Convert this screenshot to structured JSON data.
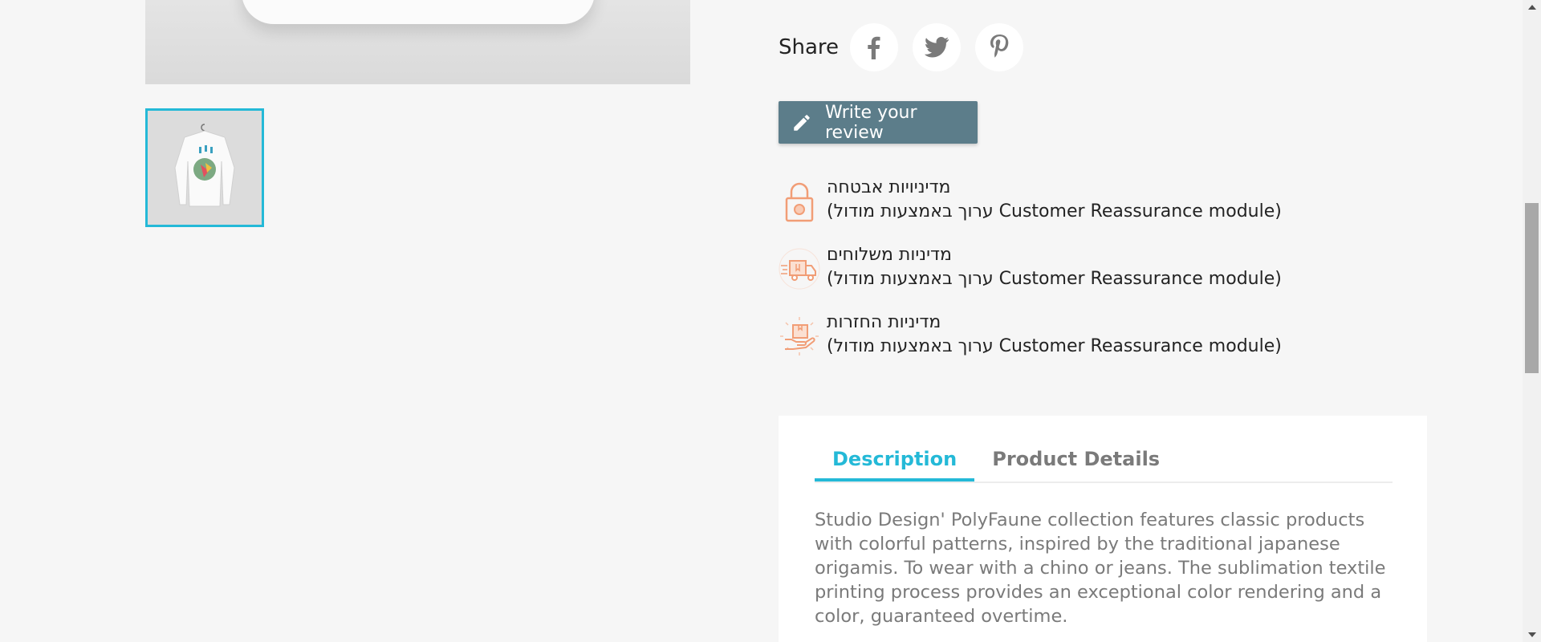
{
  "share": {
    "label": "Share",
    "icons": [
      "facebook-icon",
      "twitter-icon",
      "pinterest-icon"
    ]
  },
  "review": {
    "button_label": "Write your review"
  },
  "reassurance": [
    {
      "title": "מדיניויות אבטחה",
      "description": "(ערוך באמצעות מודול Customer Reassurance module)",
      "icon": "lock-icon"
    },
    {
      "title": "מדיניות משלוחים",
      "description": "(ערוך באמצעות מודול Customer Reassurance module)",
      "icon": "delivery-truck-icon"
    },
    {
      "title": "מדיניות החזרות",
      "description": "(ערוך באמצעות מודול Customer Reassurance module)",
      "icon": "return-parcel-icon"
    }
  ],
  "tabs": [
    {
      "label": "Description",
      "active": true
    },
    {
      "label": "Product Details",
      "active": false
    }
  ],
  "description_text": "Studio Design' PolyFaune collection features classic products with colorful patterns, inspired by the traditional japanese origamis. To wear with a chino or jeans. The sublimation textile printing process provides an exceptional color rendering and a color, guaranteed overtime.",
  "colors": {
    "accent": "#24b9d7",
    "review_button": "#5c7d8a",
    "reassurance_icon": "#f19d76",
    "background": "#f6f6f6"
  }
}
